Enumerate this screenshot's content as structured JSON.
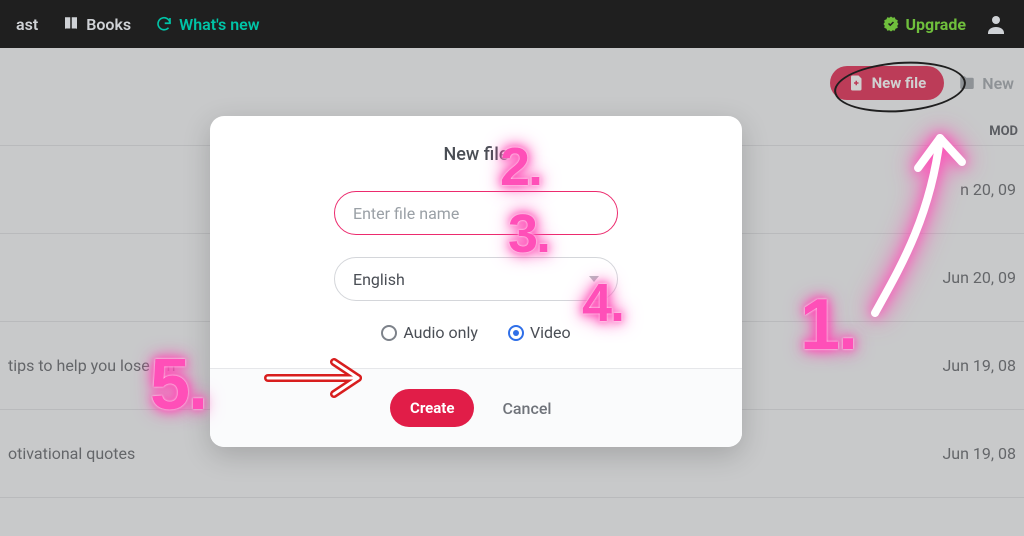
{
  "nav": {
    "podcast_partial": "ast",
    "books": "Books",
    "whats_new": "What's new",
    "upgrade": "Upgrade"
  },
  "toolbar": {
    "new_file": "New file",
    "new_folder_partial": "New"
  },
  "table": {
    "modified_header_partial": "MOD",
    "rows": [
      {
        "title": "",
        "date": "n 20, 09"
      },
      {
        "title": "",
        "date": "Jun 20, 09"
      },
      {
        "title": "tips to help you lose   igh",
        "date": "Jun 19, 08"
      },
      {
        "title": "otivational quotes",
        "date": "Jun 19, 08"
      }
    ]
  },
  "modal": {
    "title": "New file",
    "name_placeholder": "Enter file name",
    "language": "English",
    "opt_audio": "Audio only",
    "opt_video": "Video",
    "selected": "video",
    "create": "Create",
    "cancel": "Cancel"
  },
  "annotations": {
    "n1": "1.",
    "n2": "2.",
    "n3": "3.",
    "n4": "4.",
    "n5": "5."
  },
  "colors": {
    "accent": "#e11d48",
    "neon": "#ff4fb8",
    "teal": "#00c4a7",
    "upgrade": "#6fbf3c"
  }
}
